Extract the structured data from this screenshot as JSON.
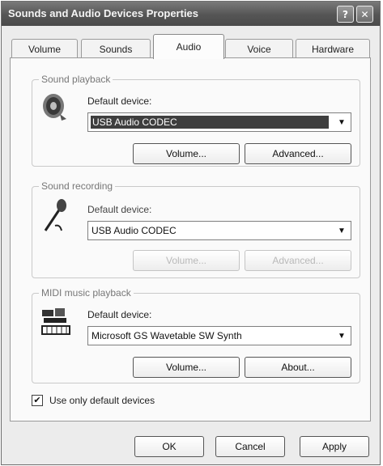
{
  "window": {
    "title": "Sounds and Audio Devices Properties",
    "help_label": "?",
    "close_label": "✕"
  },
  "tabs": [
    {
      "label": "Volume"
    },
    {
      "label": "Sounds"
    },
    {
      "label": "Audio",
      "active": true
    },
    {
      "label": "Voice"
    },
    {
      "label": "Hardware"
    }
  ],
  "playback": {
    "legend": "Sound playback",
    "device_label": "Default device:",
    "device_value": "USB Audio CODEC",
    "volume_label": "Volume...",
    "advanced_label": "Advanced..."
  },
  "recording": {
    "legend": "Sound recording",
    "device_label": "Default device:",
    "device_value": "USB Audio CODEC",
    "volume_label": "Volume...",
    "advanced_label": "Advanced..."
  },
  "midi": {
    "legend": "MIDI music playback",
    "device_label": "Default device:",
    "device_value": "Microsoft GS Wavetable SW Synth",
    "volume_label": "Volume...",
    "about_label": "About..."
  },
  "options": {
    "use_default_label": "Use only default devices",
    "use_default_checked": "✔"
  },
  "footer": {
    "ok_label": "OK",
    "cancel_label": "Cancel",
    "apply_label": "Apply"
  },
  "icons": {
    "speaker": "speaker-icon",
    "microphone": "microphone-icon",
    "midi": "midi-keyboard-icon",
    "dropdown": "chevron-down-icon"
  }
}
